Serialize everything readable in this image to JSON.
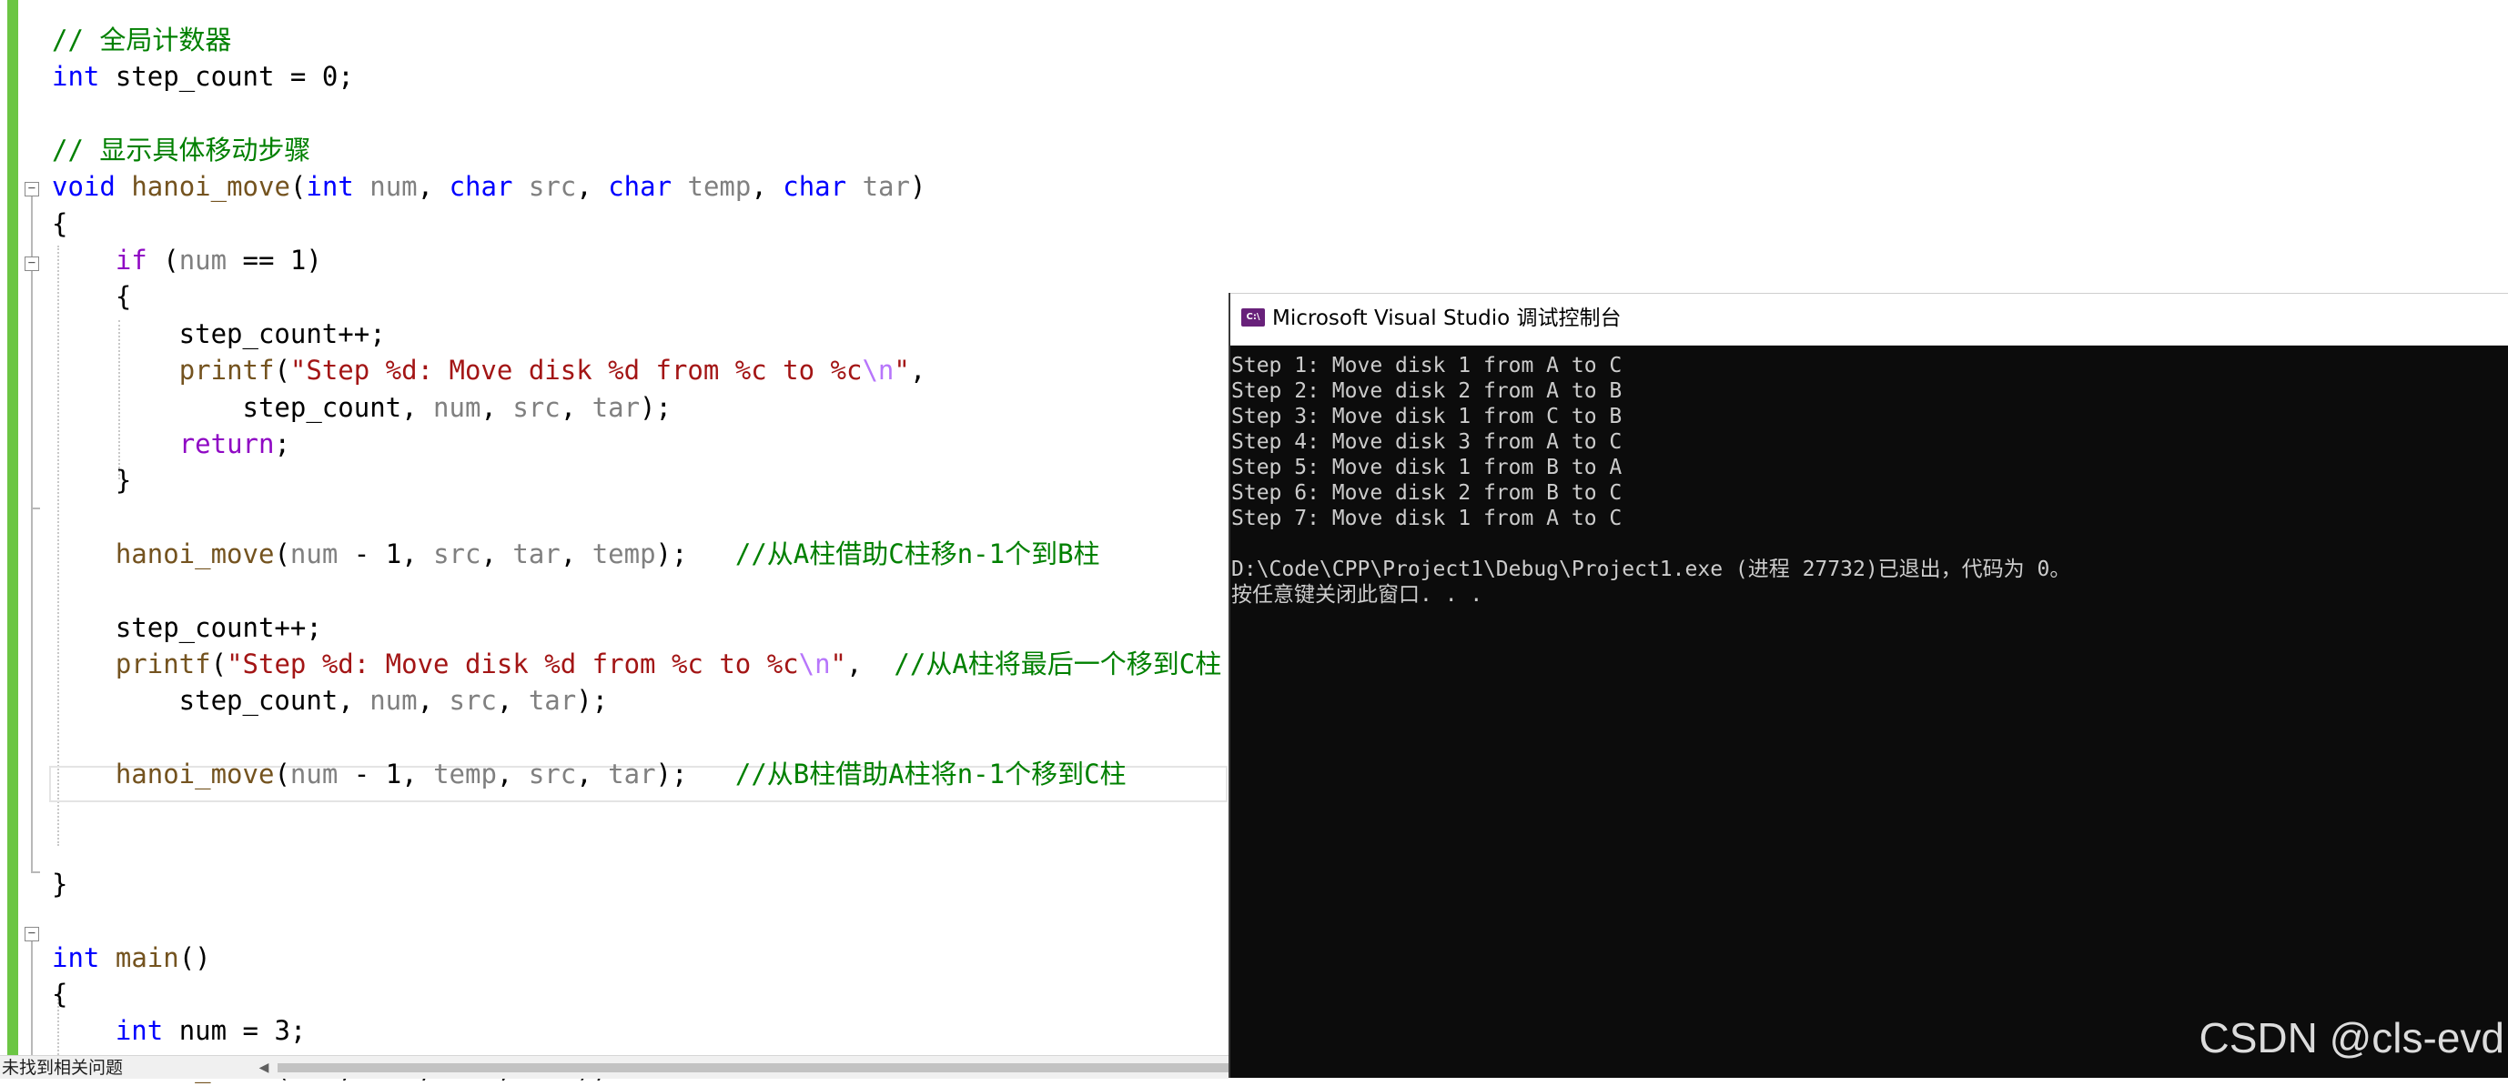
{
  "editor": {
    "code_lines": [
      [
        {
          "t": "// 全局计数器",
          "c": "cm"
        }
      ],
      [
        {
          "t": "int",
          "c": "kw"
        },
        {
          "t": " step_count = 0;",
          "c": "pl"
        }
      ],
      [],
      [
        {
          "t": "// 显示具体移动步骤",
          "c": "cm"
        }
      ],
      [
        {
          "t": "void",
          "c": "kw"
        },
        {
          "t": " ",
          "c": "pl"
        },
        {
          "t": "hanoi_move",
          "c": "fn"
        },
        {
          "t": "(",
          "c": "pl"
        },
        {
          "t": "int",
          "c": "kw"
        },
        {
          "t": " ",
          "c": "pl"
        },
        {
          "t": "num",
          "c": "pa"
        },
        {
          "t": ", ",
          "c": "pl"
        },
        {
          "t": "char",
          "c": "kw"
        },
        {
          "t": " ",
          "c": "pl"
        },
        {
          "t": "src",
          "c": "pa"
        },
        {
          "t": ", ",
          "c": "pl"
        },
        {
          "t": "char",
          "c": "kw"
        },
        {
          "t": " ",
          "c": "pl"
        },
        {
          "t": "temp",
          "c": "pa"
        },
        {
          "t": ", ",
          "c": "pl"
        },
        {
          "t": "char",
          "c": "kw"
        },
        {
          "t": " ",
          "c": "pl"
        },
        {
          "t": "tar",
          "c": "pa"
        },
        {
          "t": ")",
          "c": "pl"
        }
      ],
      [
        {
          "t": "{",
          "c": "pl"
        }
      ],
      [
        {
          "t": "    ",
          "c": "pl"
        },
        {
          "t": "if",
          "c": "kp"
        },
        {
          "t": " (",
          "c": "pl"
        },
        {
          "t": "num",
          "c": "pa"
        },
        {
          "t": " == 1)",
          "c": "pl"
        }
      ],
      [
        {
          "t": "    {",
          "c": "pl"
        }
      ],
      [
        {
          "t": "        step_count++;",
          "c": "pl"
        }
      ],
      [
        {
          "t": "        ",
          "c": "pl"
        },
        {
          "t": "printf",
          "c": "fn"
        },
        {
          "t": "(",
          "c": "pl"
        },
        {
          "t": "\"Step %d: Move disk %d from %c to %c",
          "c": "st"
        },
        {
          "t": "\\n",
          "c": "es"
        },
        {
          "t": "\"",
          "c": "st"
        },
        {
          "t": ",",
          "c": "pl"
        }
      ],
      [
        {
          "t": "            step_count, ",
          "c": "pl"
        },
        {
          "t": "num",
          "c": "pa"
        },
        {
          "t": ", ",
          "c": "pl"
        },
        {
          "t": "src",
          "c": "pa"
        },
        {
          "t": ", ",
          "c": "pl"
        },
        {
          "t": "tar",
          "c": "pa"
        },
        {
          "t": ");",
          "c": "pl"
        }
      ],
      [
        {
          "t": "        ",
          "c": "pl"
        },
        {
          "t": "return",
          "c": "kp"
        },
        {
          "t": ";",
          "c": "pl"
        }
      ],
      [
        {
          "t": "    }",
          "c": "pl"
        }
      ],
      [],
      [
        {
          "t": "    ",
          "c": "pl"
        },
        {
          "t": "hanoi_move",
          "c": "fn"
        },
        {
          "t": "(",
          "c": "pl"
        },
        {
          "t": "num",
          "c": "pa"
        },
        {
          "t": " - 1, ",
          "c": "pl"
        },
        {
          "t": "src",
          "c": "pa"
        },
        {
          "t": ", ",
          "c": "pl"
        },
        {
          "t": "tar",
          "c": "pa"
        },
        {
          "t": ", ",
          "c": "pl"
        },
        {
          "t": "temp",
          "c": "pa"
        },
        {
          "t": ");   ",
          "c": "pl"
        },
        {
          "t": "//从A柱借助C柱移n-1个到B柱",
          "c": "cm"
        }
      ],
      [],
      [
        {
          "t": "    step_count++;",
          "c": "pl"
        }
      ],
      [
        {
          "t": "    ",
          "c": "pl"
        },
        {
          "t": "printf",
          "c": "fn"
        },
        {
          "t": "(",
          "c": "pl"
        },
        {
          "t": "\"Step %d: Move disk %d from %c to %c",
          "c": "st"
        },
        {
          "t": "\\n",
          "c": "es"
        },
        {
          "t": "\"",
          "c": "st"
        },
        {
          "t": ",  ",
          "c": "pl"
        },
        {
          "t": "//从A柱将最后一个移到C柱",
          "c": "cm"
        }
      ],
      [
        {
          "t": "        step_count, ",
          "c": "pl"
        },
        {
          "t": "num",
          "c": "pa"
        },
        {
          "t": ", ",
          "c": "pl"
        },
        {
          "t": "src",
          "c": "pa"
        },
        {
          "t": ", ",
          "c": "pl"
        },
        {
          "t": "tar",
          "c": "pa"
        },
        {
          "t": ");",
          "c": "pl"
        }
      ],
      [],
      [
        {
          "t": "    ",
          "c": "pl"
        },
        {
          "t": "hanoi_move",
          "c": "fn"
        },
        {
          "t": "(",
          "c": "pl"
        },
        {
          "t": "num",
          "c": "pa"
        },
        {
          "t": " - 1, ",
          "c": "pl"
        },
        {
          "t": "temp",
          "c": "pa"
        },
        {
          "t": ", ",
          "c": "pl"
        },
        {
          "t": "src",
          "c": "pa"
        },
        {
          "t": ", ",
          "c": "pl"
        },
        {
          "t": "tar",
          "c": "pa"
        },
        {
          "t": ");   ",
          "c": "pl"
        },
        {
          "t": "//从B柱借助A柱将n-1个移到C柱",
          "c": "cm"
        }
      ],
      [],
      [],
      [
        {
          "t": "}",
          "c": "pl"
        }
      ],
      [],
      [
        {
          "t": "int",
          "c": "kw"
        },
        {
          "t": " ",
          "c": "pl"
        },
        {
          "t": "main",
          "c": "fn"
        },
        {
          "t": "()",
          "c": "pl"
        }
      ],
      [
        {
          "t": "{",
          "c": "pl"
        }
      ],
      [
        {
          "t": "    ",
          "c": "pl"
        },
        {
          "t": "int",
          "c": "kw"
        },
        {
          "t": " ",
          "c": "pl"
        },
        {
          "t": "num",
          "c": "pl"
        },
        {
          "t": " = 3;",
          "c": "pl"
        }
      ],
      [
        {
          "t": "    ",
          "c": "pl"
        },
        {
          "t": "hanoi_move",
          "c": "fn"
        },
        {
          "t": "(",
          "c": "pl"
        },
        {
          "t": "num",
          "c": "pl"
        },
        {
          "t": ", ",
          "c": "pl"
        },
        {
          "t": "'A'",
          "c": "st"
        },
        {
          "t": ", ",
          "c": "pl"
        },
        {
          "t": "'B'",
          "c": "st"
        },
        {
          "t": ", ",
          "c": "pl"
        },
        {
          "t": "'C'",
          "c": "st"
        },
        {
          "t": ");",
          "c": "pl"
        }
      ]
    ]
  },
  "status_bar": {
    "message": "未找到相关问题"
  },
  "console": {
    "title": "Microsoft Visual Studio 调试控制台",
    "icon_label": "C:\\",
    "lines": [
      "Step 1: Move disk 1 from A to C",
      "Step 2: Move disk 2 from A to B",
      "Step 3: Move disk 1 from C to B",
      "Step 4: Move disk 3 from A to C",
      "Step 5: Move disk 1 from B to A",
      "Step 6: Move disk 2 from B to C",
      "Step 7: Move disk 1 from A to C",
      "",
      "D:\\Code\\CPP\\Project1\\Debug\\Project1.exe (进程 27732)已退出，代码为 0。",
      "按任意键关闭此窗口. . ."
    ]
  },
  "watermark": "CSDN @cls-evd",
  "colors": {
    "comment": "#008000",
    "keyword": "#0000ff",
    "control_keyword": "#8f08c4",
    "function": "#74531f",
    "parameter": "#808080",
    "string": "#a31515",
    "escape": "#b776fb",
    "change_bar": "#6cc644",
    "console_bg": "#0c0c0c",
    "console_text": "#cccccc"
  },
  "icons": [
    "fold-collapse-icon",
    "console-app-icon",
    "scroll-left-arrow-icon"
  ]
}
